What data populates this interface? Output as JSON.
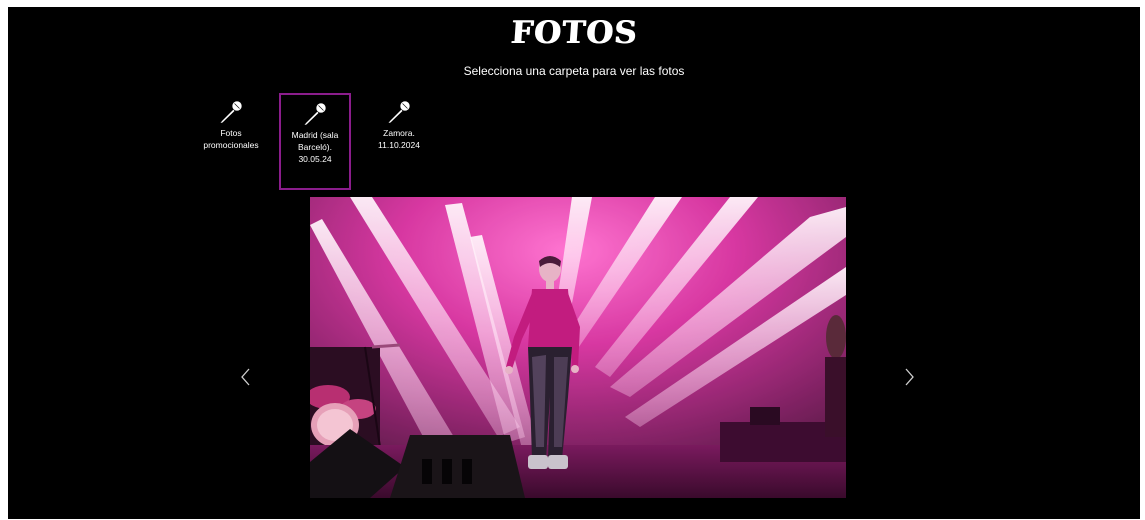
{
  "header": {
    "title": "FOTOS",
    "subtitle": "Selecciona una carpeta para ver las fotos"
  },
  "folders": [
    {
      "label": "Fotos promocionales",
      "icon": "microphone-icon",
      "selected": false
    },
    {
      "label": "Madrid (sala Barceló). 30.05.24",
      "icon": "microphone-icon",
      "selected": true
    },
    {
      "label": "Zamora. 11.10.2024",
      "icon": "microphone-icon",
      "selected": false
    }
  ],
  "carousel": {
    "prev_icon": "chevron-left-icon",
    "next_icon": "chevron-right-icon"
  },
  "colors": {
    "background": "#000000",
    "text": "#ffffff",
    "selected_border": "#8b1d8c",
    "stage_light_pink": "#d9279a"
  }
}
